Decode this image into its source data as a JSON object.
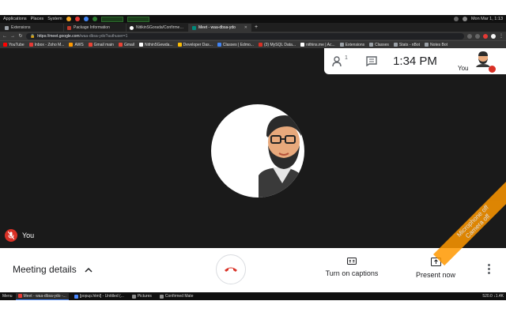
{
  "system_panel": {
    "menus": [
      "Applications",
      "Places",
      "System"
    ],
    "clock": "Mon Mar 1, 1:13"
  },
  "tabs": [
    {
      "label": "Extensions",
      "color": "#9aa0a6"
    },
    {
      "label": "Package Information",
      "color": "#c0392b"
    },
    {
      "label": "NitikinSGorada/Confirmed-Fi",
      "color": "#ffffff"
    },
    {
      "label": "Meet - waa-dbsa-ydo",
      "color": "#00897b",
      "active": true
    }
  ],
  "address_bar": {
    "host": "https://meet.google.com",
    "path": "/waa-dbsa-ydo?authuser=1"
  },
  "bookmarks": [
    {
      "label": "YouTube",
      "color": "#ff0000"
    },
    {
      "label": "Inbox - Zoho M...",
      "color": "#e53935"
    },
    {
      "label": "AWS",
      "color": "#ff9900"
    },
    {
      "label": "Gmail main",
      "color": "#ea4335"
    },
    {
      "label": "Gmail",
      "color": "#ea4335"
    },
    {
      "label": "Nithin5Gewda...",
      "color": "#ffffff"
    },
    {
      "label": "Developer Das...",
      "color": "#fbbc04"
    },
    {
      "label": "Classes | Edmo...",
      "color": "#4285f4"
    },
    {
      "label": "(3) MySQL Data...",
      "color": "#d93025"
    },
    {
      "label": "nithins.me | Ac...",
      "color": "#ffffff"
    },
    {
      "label": "Extensions",
      "color": "#9aa0a6"
    },
    {
      "label": "Classes",
      "color": "#9aa0a6"
    },
    {
      "label": "Stats - nBot",
      "color": "#9aa0a6"
    },
    {
      "label": "Notes Bot",
      "color": "#9aa0a6"
    }
  ],
  "meet": {
    "participants_count": "1",
    "time": "1:34 PM",
    "self_label": "You",
    "speaker_label": "You"
  },
  "controls": {
    "meeting_details": "Meeting details",
    "captions": "Turn on captions",
    "present": "Present now"
  },
  "ribbon": {
    "line1": "Microphone off",
    "line2": "Camera off"
  },
  "taskbar": {
    "menu": "Menu",
    "tasks": [
      {
        "label": "Meet - waa-dbsa-ydo -...",
        "color": "#e53935",
        "active": true
      },
      {
        "label": "[popup.html] - Untitled (...",
        "color": "#4a88ff"
      },
      {
        "label": "Pictures",
        "color": "#8d8d8d"
      },
      {
        "label": "Confirmed Mate",
        "color": "#8d8d8d"
      }
    ],
    "status": "520.0 ↓1.4K"
  },
  "colors": {
    "meet_bg": "#1a1a1a",
    "danger": "#d93025",
    "ribbon": "#ff9800"
  }
}
